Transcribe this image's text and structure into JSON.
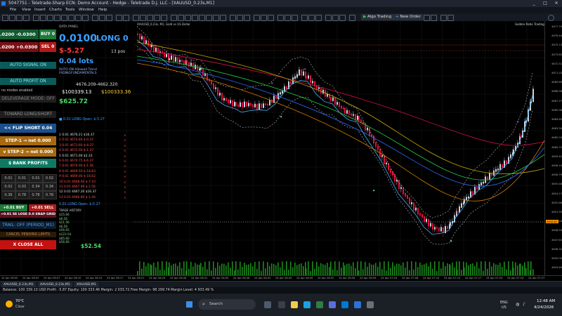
{
  "window": {
    "title": "5047751 - Teletrade-Sharp ECN: Demo Account - Hedge - Teletrade D.J. LLC - [XAUUSD_0.23s,M1]",
    "controls": [
      "_",
      "□",
      "✕"
    ]
  },
  "menu": [
    "File",
    "View",
    "Insert",
    "Charts",
    "Tools",
    "Window",
    "Help"
  ],
  "toolbar": {
    "algo_trading": "Algo Trading",
    "new_order": "New Order"
  },
  "chart": {
    "symbol_label": "XAUUSD_0.23s,M1",
    "header_text": "XAUUSD_0.23s, M1, Gold vs US Dollar",
    "indicator_label": "Golden Ratio Trading",
    "price_ticks": [
      "4677.75",
      "4676.44",
      "4675.13",
      "4673.82",
      "4672.51",
      "4671.20",
      "4669.89",
      "4668.58",
      "4667.27",
      "4665.96",
      "4664.65",
      "4663.34",
      "4662.03",
      "4660.72",
      "4659.41",
      "4658.10",
      "4656.79",
      "4655.48",
      "4654.17",
      "4652.86",
      "4651.55",
      "4650.24",
      "4648.93",
      "4647.62",
      "4646.31",
      "4645.00",
      "4643.69"
    ],
    "current_price": "4658.82",
    "time_ticks": [
      "24 Apr 06:00",
      "24 Apr 06:03",
      "24 Apr 06:07",
      "24 Apr 06:10",
      "24 Apr 06:14",
      "24 Apr 06:17",
      "24 Apr 06:21",
      "24 Apr 06:24",
      "24 Apr 06:28",
      "24 Apr 06:31",
      "24 Apr 06:35",
      "24 Apr 06:38",
      "24 Apr 06:42",
      "24 Apr 06:45",
      "24 Apr 06:49",
      "24 Apr 06:52",
      "24 Apr 06:56",
      "24 Apr 06:59",
      "24 Apr 07:03",
      "24 Apr 07:06",
      "24 Apr 07:10",
      "24 Apr 07:13",
      "24 Apr 07:17",
      "24 Apr 07:20",
      "24 Apr 07:24",
      "24 Apr 07:27"
    ]
  },
  "panel": {
    "bid_price": ".0200",
    "bid_delta": "-0.0300",
    "buy_label": "BUY 0",
    "ask_price": ".0200",
    "ask_delta": "+0.0300",
    "sell_label": "SEL 0",
    "lot_header": "DATA PANEL",
    "lot_value": "0.0100",
    "long_label": "LONG 0",
    "pnl": "$-5.27",
    "positions": "13 pos",
    "lots_line": "0.04 lots",
    "auto_signal": "AUTO SIGNAL ON",
    "auto_profit": "AUTO PROFIT ON",
    "auto_on_line": "AUTO ON   Allowed Trend FADINGFUNDAMENTALS",
    "price_range": "4676.209-4662.320",
    "equity_a": "$100339.13",
    "equity_b": "$100333.36",
    "no_modes": "no modes enabled",
    "deleverage": "DELEVERAGE MODE: OFF",
    "toward": "TOWARD LONG/SHORT",
    "net_value": "$625.72",
    "flip_short": "<< FLIP SHORT  0.04",
    "step1": "STEP-1  → net 0.000",
    "step2": "v STEP-2 → net 0.000",
    "bank": "$  BANK PROFITS",
    "grid_values": [
      "0.01",
      "0.01",
      "0.01",
      "0.02",
      "0.02",
      "0.03",
      "0.34",
      "0.34",
      "0.36",
      "0.78",
      "0.78",
      "0.78"
    ],
    "buy_small": "+0.01 BUY",
    "sell_small": "+0.01 SELL",
    "grid_row": "+0.01 SE  LOSE 0.0  SNAP GRID",
    "trail": "TRAIL: OFF  (PERIOD_M1)",
    "cancel_pending": "CANCEL PENDING LIMITS",
    "close_all": "X  CLOSE ALL",
    "orders_header": "0.01 LONG  Open: $-5.27",
    "order_rows": [
      "1 0.01  4676.21  $16.37",
      "2 0.01  4674.80  $-0.37",
      "3 0.01  4673.60  $-8.37",
      "4 0.01  4672.00  $-1.37",
      "5 0.01  4671.00  $2.33",
      "6 0.01  4670.75  $-6.37",
      "7 0.01  4670.00  $-1.56",
      "8 0.01  4669.50  $-18.83",
      "9 0.01  4669.00  $-16.62",
      "10 0.01  4668.40  $-7.10",
      "11 0.01  4667.90  $-1.56",
      "12 0.01  4667.20  $16.37",
      "13 0.01  4666.80  $-1.40"
    ],
    "trade_history": "TRADE HISTORY",
    "history_total": "$52.54",
    "history_rows": [
      "$15.66",
      "$6.56",
      "$11.56",
      "$6.56",
      "$56.65",
      "$123.54",
      "$85.60",
      "$56.60"
    ]
  },
  "tabs": [
    "XAUUSD_0.23s,M1",
    "XAUUSD_0.23s,M1",
    "XAUUSD,M1"
  ],
  "status": "Balance: 100 339.13 USD  Profit: -5.87  Equity: 100 333.46  Margin: 2 033.72  Free Margin: 98 299.74  Margin Level: 4 933.49 %",
  "taskbar": {
    "weather_temp": "70°C",
    "weather_desc": "Clear",
    "search": "Search",
    "lang": "ENG",
    "region": "US",
    "time": "12:48 AM",
    "date": "4/24/2026"
  },
  "colors": {
    "bull": "#c8d0dc",
    "bear": "#e0103a",
    "accent_blue": "#1e90ff",
    "buy": "#1f8a2e",
    "sell": "#c41212"
  }
}
